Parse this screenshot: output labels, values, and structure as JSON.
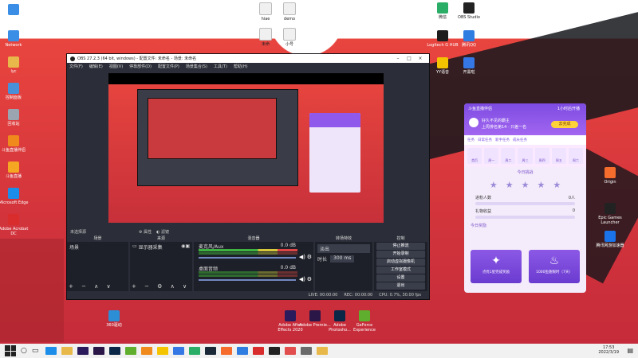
{
  "desktop": {
    "left_icons": [
      {
        "label": "此电脑",
        "icon": "computer-icon",
        "color": "#3a8ee6"
      },
      {
        "label": "Network",
        "icon": "network-icon",
        "color": "#3a8ee6"
      },
      {
        "label": "lyc",
        "icon": "folder-icon",
        "color": "#e8b94a"
      },
      {
        "label": "控制面板",
        "icon": "control-panel-icon",
        "color": "#4a90d9"
      },
      {
        "label": "回收站",
        "icon": "recycle-bin-icon",
        "color": "#9aa5b1"
      },
      {
        "label": "斗鱼直播伴侣",
        "icon": "douyu-icon",
        "color": "#f08a1c"
      },
      {
        "label": "斗鱼直播",
        "icon": "douyu-live-icon",
        "color": "#f5a623"
      },
      {
        "label": "Microsoft Edge",
        "icon": "edge-icon",
        "color": "#1c8de8"
      },
      {
        "label": "Adobe Acrobat DC",
        "icon": "acrobat-icon",
        "color": "#d92d2d"
      }
    ],
    "top_icons": [
      {
        "label": "hiae",
        "icon": "file-icon"
      },
      {
        "label": "demo",
        "icon": "file-icon"
      },
      {
        "label": "未命",
        "icon": "file-icon"
      },
      {
        "label": "小号",
        "icon": "file-icon"
      }
    ],
    "right_icons": [
      {
        "label": "微信",
        "icon": "wechat-icon",
        "color": "#2aae67"
      },
      {
        "label": "OBS Studio",
        "icon": "obs-icon",
        "color": "#222"
      },
      {
        "label": "Logitech G HUB",
        "icon": "logitech-icon",
        "color": "#1d1d1d"
      },
      {
        "label": "腾讯QQ",
        "icon": "qq-icon",
        "color": "#2f7de1"
      },
      {
        "label": "YY语音",
        "icon": "yy-icon",
        "color": "#f5c400"
      },
      {
        "label": "开黑啦",
        "icon": "kaiheila-icon",
        "color": "#3578e5"
      },
      {
        "label": "Origin",
        "icon": "origin-icon",
        "color": "#f56c2d"
      },
      {
        "label": "Epic Games Launcher",
        "icon": "epic-icon",
        "color": "#222"
      },
      {
        "label": "腾讯网游加速器",
        "icon": "booster-icon",
        "color": "#1a73e8"
      }
    ],
    "bottom_icons": [
      {
        "label": "360驱动",
        "icon": "driver-icon",
        "color": "#2c8fd6"
      },
      {
        "label": "Adobe After Effects 2020",
        "icon": "after-effects-icon",
        "color": "#2c1b5c"
      },
      {
        "label": "Adobe Premie...",
        "icon": "premiere-icon",
        "color": "#2a1747"
      },
      {
        "label": "Adobe Photosho...",
        "icon": "photoshop-icon",
        "color": "#0b2747"
      },
      {
        "label": "GeForce Experience",
        "icon": "geforce-icon",
        "color": "#5fae2e"
      }
    ]
  },
  "obs": {
    "title": "OBS 27.2.3 (64 bit, windows) - 配置文件: 未命名 - 场景: 未命名",
    "menu": [
      "文件(F)",
      "编辑(E)",
      "视图(V)",
      "停靠部件(D)",
      "配置文件(P)",
      "场景集合(S)",
      "工具(T)",
      "帮助(H)"
    ],
    "preview_label": "未选择源",
    "toolbar": [
      "属性",
      "滤镜"
    ],
    "docks": {
      "scenes": {
        "title": "场景",
        "items": [
          "场景"
        ]
      },
      "sources": {
        "title": "来源",
        "items": [
          "显示器采集"
        ]
      },
      "mixer": {
        "title": "混音器",
        "channels": [
          {
            "name": "麦克风/Aux",
            "level": "0.0 dB"
          },
          {
            "name": "桌面音频",
            "level": "0.0 dB"
          }
        ]
      },
      "transitions": {
        "title": "转场特效",
        "mode": "淡出",
        "duration_label": "时长",
        "duration": "300 ms"
      },
      "controls": {
        "title": "控制",
        "buttons": [
          "停止推流",
          "开始录制",
          "启动虚拟摄像机",
          "工作室模式",
          "设置",
          "退出"
        ]
      }
    },
    "status": {
      "live": "LIVE: 00:00:00",
      "rec": "REC: 00:00:00",
      "cpu": "CPU: 0.7%, 30.00 fps"
    }
  },
  "widget": {
    "title": "斗鱼直播伴侣",
    "header_text": "1小时后开播",
    "user": "好久不见的霸主",
    "sub": "上周排名第14 · 只差一名",
    "button": "去完成",
    "tabs": [
      "任务",
      "日常任务",
      "新手任务",
      "成长任务"
    ],
    "categories": [
      "首页",
      "周一",
      "周二",
      "周三",
      "周四",
      "周五",
      "周六"
    ],
    "section": "今日挑战",
    "rows": [
      {
        "label": "进粉人数",
        "value": "0人"
      },
      {
        "label": "礼物收益",
        "value": "0"
      }
    ],
    "section2": "今日奖励",
    "cards": [
      "点亮1星完成奖励",
      "1000鱼翅限时（7天）"
    ]
  },
  "taskbar": {
    "time": "17:53",
    "date": "2022/3/19"
  }
}
